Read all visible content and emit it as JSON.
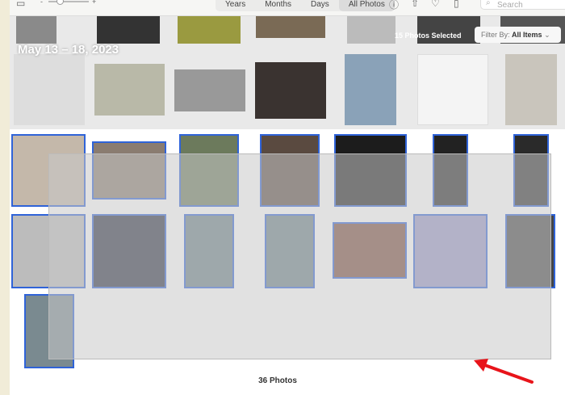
{
  "toolbar": {
    "zoom_minus": "-",
    "zoom_plus": "+",
    "tabs": [
      "Years",
      "Months",
      "Days",
      "All Photos"
    ],
    "active_tab": "All Photos",
    "search_placeholder": "Search"
  },
  "header": {
    "date": "May 13 – 18, 2023",
    "selected": "15 Photos Selected",
    "filter_label": "Filter By:",
    "filter_value": "All Items"
  },
  "footer": {
    "count": "36 Photos"
  },
  "colors": {
    "selection": "#2f63d8",
    "arrow": "#e8141a"
  }
}
